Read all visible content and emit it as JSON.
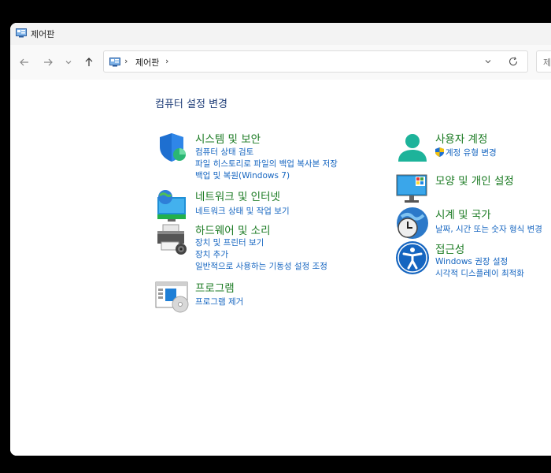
{
  "window": {
    "title": "제어판"
  },
  "address": {
    "crumb": "제어판",
    "sep": "›"
  },
  "search": {
    "placeholder": "제"
  },
  "page": {
    "heading": "컴퓨터 설정 변경"
  },
  "categories": {
    "system": {
      "name": "시스템 및 보안",
      "links": [
        "컴퓨터 상태 검토",
        "파일 히스토리로 파일의 백업 복사본 저장",
        "백업 및 복원(Windows 7)"
      ]
    },
    "network": {
      "name": "네트워크 및 인터넷",
      "links": [
        "네트워크 상태 및 작업 보기"
      ]
    },
    "hardware": {
      "name": "하드웨어 및 소리",
      "links": [
        "장치 및 프린터 보기",
        "장치 추가",
        "일반적으로 사용하는 기동성 설정 조정"
      ]
    },
    "programs": {
      "name": "프로그램",
      "links": [
        "프로그램 제거"
      ]
    },
    "users": {
      "name": "사용자 계정",
      "links": [
        "계정 유형 변경"
      ]
    },
    "appearance": {
      "name": "모양 및 개인 설정",
      "links": []
    },
    "clock": {
      "name": "시계 및 국가",
      "links": [
        "날짜, 시간 또는 숫자 형식 변경"
      ]
    },
    "access": {
      "name": "접근성",
      "links": [
        "Windows 권장 설정",
        "시각적 디스플레이 최적화"
      ]
    }
  },
  "colors": {
    "category": "#1a7a22",
    "link": "#1565c0",
    "heading": "#1e3d78"
  }
}
